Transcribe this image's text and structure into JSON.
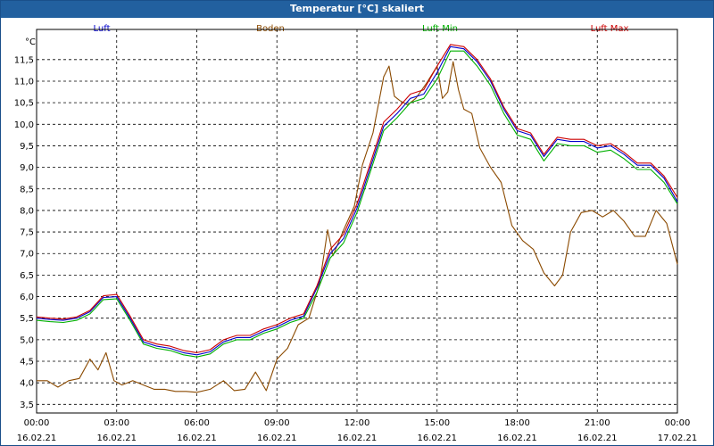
{
  "window": {
    "title": "Temperatur [°C] skaliert"
  },
  "colors": {
    "titlebar": "#22609f",
    "Luft": "#0000cc",
    "Boden": "#8b4a00",
    "Luft Min": "#00b000",
    "Luft Max": "#cc0000",
    "grid": "#000000"
  },
  "chart_data": {
    "type": "line",
    "title": "Temperatur [°C] skaliert",
    "unit_label": "°C",
    "ylim": [
      3.3,
      12.2
    ],
    "yticks": [
      "3,5",
      "4,0",
      "4,5",
      "5,0",
      "5,5",
      "6,0",
      "6,5",
      "7,0",
      "7,5",
      "8,0",
      "8,5",
      "9,0",
      "9,5",
      "10,0",
      "10,5",
      "11,0",
      "11,5"
    ],
    "ytick_values": [
      3.5,
      4.0,
      4.5,
      5.0,
      5.5,
      6.0,
      6.5,
      7.0,
      7.5,
      8.0,
      8.5,
      9.0,
      9.5,
      10.0,
      10.5,
      11.0,
      11.5
    ],
    "xlim": [
      0,
      24
    ],
    "xtick_hours": [
      0,
      3,
      6,
      9,
      12,
      15,
      18,
      21,
      24
    ],
    "xtick_times": [
      "00:00",
      "03:00",
      "06:00",
      "09:00",
      "12:00",
      "15:00",
      "18:00",
      "21:00",
      "00:00"
    ],
    "xtick_dates": [
      "16.02.21",
      "16.02.21",
      "16.02.21",
      "16.02.21",
      "16.02.21",
      "16.02.21",
      "16.02.21",
      "16.02.21",
      "17.02.21"
    ],
    "grid": true,
    "legend_position": "top",
    "series": [
      {
        "name": "Luft",
        "color": "#0000cc",
        "x": [
          0,
          0.5,
          1,
          1.5,
          2,
          2.5,
          3,
          3.5,
          4,
          4.5,
          5,
          5.5,
          6,
          6.5,
          7,
          7.5,
          8,
          8.5,
          9,
          9.5,
          10,
          10.5,
          11,
          11.5,
          12,
          12.5,
          13,
          13.5,
          14,
          14.5,
          15,
          15.5,
          16,
          16.5,
          17,
          17.5,
          18,
          18.5,
          19,
          19.5,
          20,
          20.5,
          21,
          21.5,
          22,
          22.5,
          23,
          23.5,
          24
        ],
        "values": [
          5.5,
          5.47,
          5.45,
          5.5,
          5.65,
          5.98,
          6.0,
          5.5,
          4.95,
          4.85,
          4.8,
          4.7,
          4.65,
          4.72,
          4.95,
          5.05,
          5.05,
          5.2,
          5.3,
          5.45,
          5.55,
          6.2,
          7.0,
          7.35,
          8.05,
          9.0,
          9.95,
          10.25,
          10.6,
          10.7,
          11.2,
          11.8,
          11.75,
          11.45,
          11.0,
          10.35,
          9.85,
          9.75,
          9.25,
          9.65,
          9.6,
          9.6,
          9.45,
          9.5,
          9.3,
          9.05,
          9.05,
          8.75,
          8.2
        ]
      },
      {
        "name": "Boden",
        "color": "#8b4a00",
        "x": [
          0,
          0.4,
          0.8,
          1.2,
          1.6,
          2,
          2.3,
          2.6,
          2.9,
          3.2,
          3.6,
          4,
          4.4,
          4.8,
          5.2,
          5.6,
          6,
          6.5,
          7,
          7.4,
          7.8,
          8.2,
          8.6,
          9,
          9.4,
          9.8,
          10.2,
          10.6,
          10.9,
          11.1,
          11.5,
          11.9,
          12.2,
          12.6,
          13,
          13.2,
          13.4,
          13.6,
          13.9,
          14.2,
          14.6,
          15,
          15.2,
          15.4,
          15.6,
          15.8,
          16,
          16.3,
          16.6,
          17,
          17.4,
          17.8,
          18.2,
          18.6,
          19,
          19.4,
          19.7,
          20,
          20.4,
          20.8,
          21.2,
          21.6,
          22,
          22.4,
          22.8,
          23.2,
          23.6,
          24
        ],
        "values": [
          4.05,
          4.05,
          3.9,
          4.05,
          4.1,
          4.55,
          4.3,
          4.7,
          4.05,
          3.95,
          4.05,
          3.95,
          3.85,
          3.85,
          3.8,
          3.8,
          3.78,
          3.85,
          4.05,
          3.82,
          3.85,
          4.25,
          3.82,
          4.55,
          4.8,
          5.35,
          5.5,
          6.3,
          7.55,
          6.95,
          7.55,
          8.1,
          9.05,
          9.8,
          11.1,
          11.35,
          10.65,
          10.55,
          10.45,
          10.6,
          10.95,
          11.35,
          10.6,
          10.75,
          11.45,
          10.8,
          10.35,
          10.25,
          9.45,
          9.0,
          8.65,
          7.65,
          7.3,
          7.1,
          6.55,
          6.25,
          6.5,
          7.5,
          7.95,
          8.0,
          7.85,
          8.0,
          7.75,
          7.4,
          7.4,
          8.0,
          7.7,
          6.75
        ]
      },
      {
        "name": "Luft Min",
        "color": "#00b000",
        "x": [
          0,
          0.5,
          1,
          1.5,
          2,
          2.5,
          3,
          3.5,
          4,
          4.5,
          5,
          5.5,
          6,
          6.5,
          7,
          7.5,
          8,
          8.5,
          9,
          9.5,
          10,
          10.5,
          11,
          11.5,
          12,
          12.5,
          13,
          13.5,
          14,
          14.5,
          15,
          15.5,
          16,
          16.5,
          17,
          17.5,
          18,
          18.5,
          19,
          19.5,
          20,
          20.5,
          21,
          21.5,
          22,
          22.5,
          23,
          23.5,
          24
        ],
        "values": [
          5.45,
          5.42,
          5.4,
          5.45,
          5.6,
          5.93,
          5.95,
          5.45,
          4.9,
          4.8,
          4.75,
          4.65,
          4.6,
          4.67,
          4.9,
          5.0,
          5.0,
          5.15,
          5.25,
          5.4,
          5.5,
          6.1,
          6.9,
          7.25,
          7.95,
          8.9,
          9.85,
          10.15,
          10.5,
          10.6,
          11.05,
          11.7,
          11.7,
          11.35,
          10.9,
          10.25,
          9.75,
          9.65,
          9.15,
          9.55,
          9.5,
          9.5,
          9.35,
          9.4,
          9.2,
          8.95,
          8.95,
          8.65,
          8.15
        ]
      },
      {
        "name": "Luft Max",
        "color": "#cc0000",
        "x": [
          0,
          0.5,
          1,
          1.5,
          2,
          2.5,
          3,
          3.5,
          4,
          4.5,
          5,
          5.5,
          6,
          6.5,
          7,
          7.5,
          8,
          8.5,
          9,
          9.5,
          10,
          10.5,
          11,
          11.5,
          12,
          12.5,
          13,
          13.5,
          14,
          14.5,
          15,
          15.5,
          16,
          16.5,
          17,
          17.5,
          18,
          18.5,
          19,
          19.5,
          20,
          20.5,
          21,
          21.5,
          22,
          22.5,
          23,
          23.5,
          24
        ],
        "values": [
          5.53,
          5.5,
          5.48,
          5.53,
          5.68,
          6.02,
          6.05,
          5.55,
          5.0,
          4.9,
          4.85,
          4.75,
          4.7,
          4.77,
          5.0,
          5.1,
          5.1,
          5.25,
          5.35,
          5.5,
          5.6,
          6.25,
          7.1,
          7.45,
          8.15,
          9.1,
          10.05,
          10.35,
          10.7,
          10.8,
          11.35,
          11.85,
          11.8,
          11.5,
          11.05,
          10.4,
          9.9,
          9.8,
          9.3,
          9.7,
          9.65,
          9.65,
          9.5,
          9.55,
          9.35,
          9.1,
          9.1,
          8.8,
          8.3
        ]
      }
    ]
  }
}
